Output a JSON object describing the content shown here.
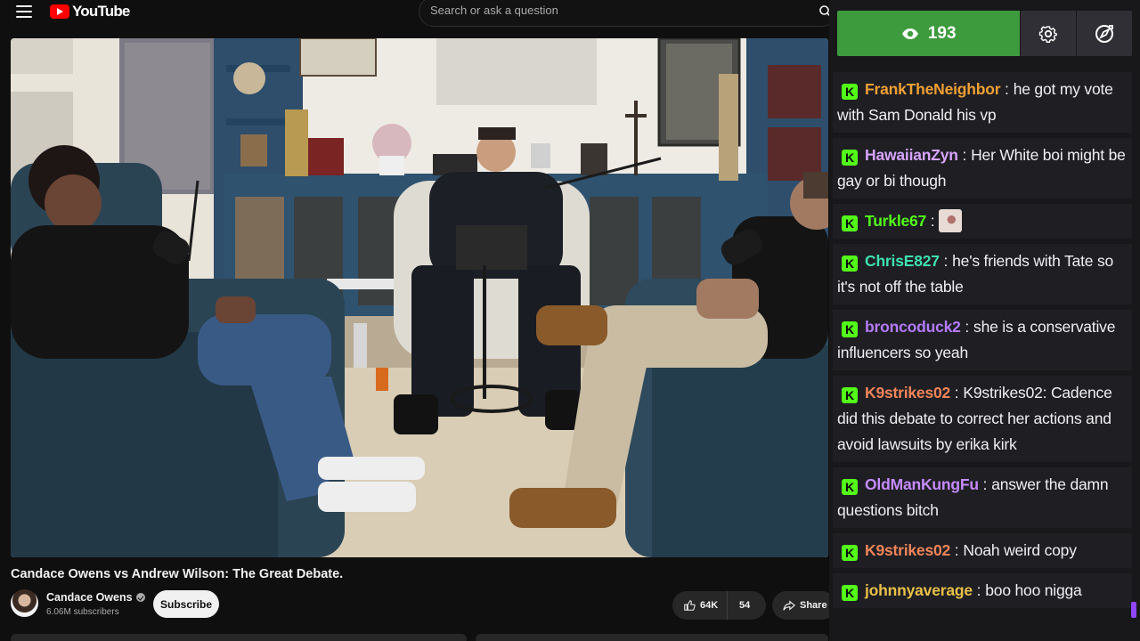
{
  "header": {
    "logo_text": "YouTube",
    "search_placeholder": "Search or ask a question"
  },
  "video": {
    "title": "Candace Owens vs Andrew Wilson: The Great Debate.",
    "channel_name": "Candace Owens",
    "subscribers": "6.06M subscribers",
    "subscribe_label": "Subscribe",
    "likes": "64K",
    "dislikes_label": "54",
    "share_label": "Share"
  },
  "chat": {
    "viewer_count": "193",
    "accent": "#53fc18",
    "messages": [
      {
        "user": "FrankTheNeighbor",
        "color": "#f0a034",
        "text": "he got my vote with Sam Donald his vp"
      },
      {
        "user": "HawaiianZyn",
        "color": "#d6a4ff",
        "text": "Her White boi might be gay or bi though"
      },
      {
        "user": "Turkle67",
        "color": "#53fc18",
        "text": "",
        "emote": true
      },
      {
        "user": "ChrisE827",
        "color": "#3ee0b0",
        "text": "he's friends with Tate so it's not off the table"
      },
      {
        "user": "broncoduck2",
        "color": "#b37bff",
        "text": "she is a conservative influencers so yeah"
      },
      {
        "user": "K9strikes02",
        "color": "#f0845a",
        "text": "K9strikes02: Cadence did this debate to correct her actions and avoid lawsuits by erika kirk"
      },
      {
        "user": "OldManKungFu",
        "color": "#c58bff",
        "text": "answer the damn questions bitch"
      },
      {
        "user": "K9strikes02",
        "color": "#f0845a",
        "text": "Noah weird copy"
      },
      {
        "user": "johnnyaverage",
        "color": "#e8c04a",
        "text": "boo hoo nigga"
      }
    ]
  }
}
